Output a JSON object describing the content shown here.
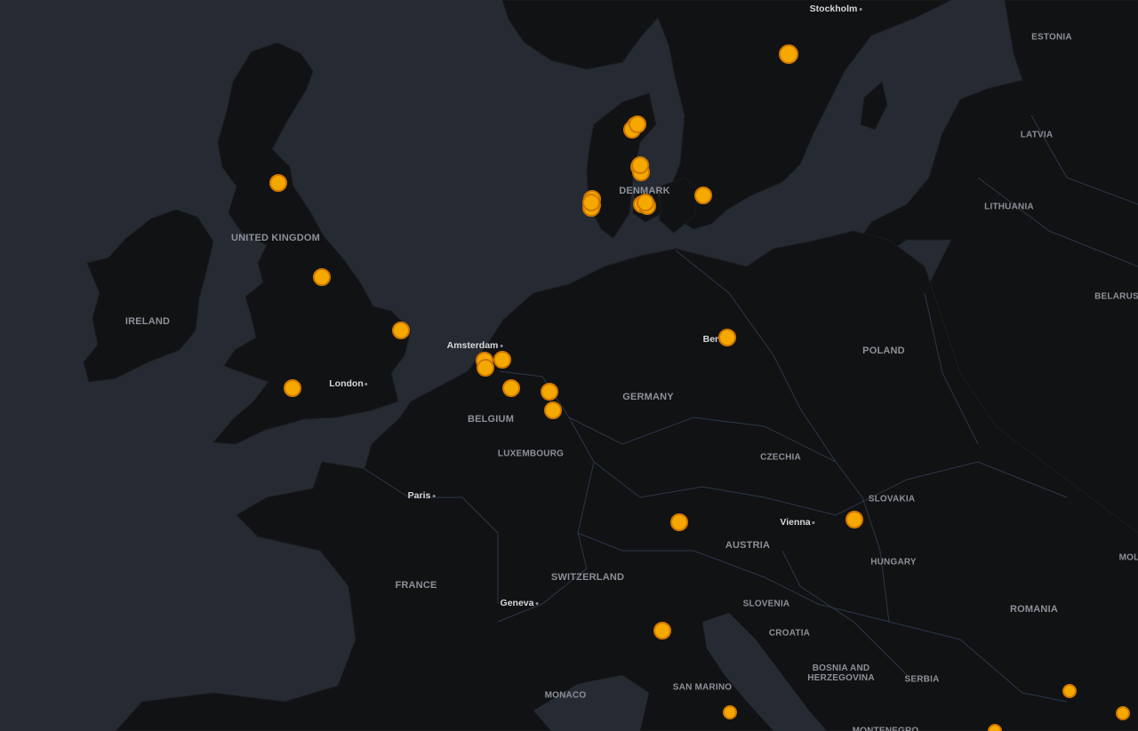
{
  "map": {
    "basemap": "dark",
    "colors": {
      "water": "#262b33",
      "land": "#111214",
      "border": "#2e3d4f",
      "marker_fill": "#f5a800",
      "marker_stroke": "#d07800"
    },
    "country_labels": [
      {
        "id": "estonia",
        "text": "ESTONIA"
      },
      {
        "id": "latvia",
        "text": "LATVIA"
      },
      {
        "id": "lithuania",
        "text": "LITHUANIA"
      },
      {
        "id": "belarus",
        "text": "BELARUS"
      },
      {
        "id": "denmark",
        "text": "DENMARK"
      },
      {
        "id": "united-kingdom",
        "text": "UNITED KINGDOM"
      },
      {
        "id": "ireland",
        "text": "IRELAND"
      },
      {
        "id": "poland",
        "text": "POLAND"
      },
      {
        "id": "germany",
        "text": "GERMANY"
      },
      {
        "id": "belgium",
        "text": "BELGIUM"
      },
      {
        "id": "luxembourg",
        "text": "LUXEMBOURG"
      },
      {
        "id": "czechia",
        "text": "CZECHIA"
      },
      {
        "id": "slovakia",
        "text": "SLOVAKIA"
      },
      {
        "id": "austria",
        "text": "AUSTRIA"
      },
      {
        "id": "hungary",
        "text": "HUNGARY"
      },
      {
        "id": "moldova",
        "text": "MOL"
      },
      {
        "id": "france",
        "text": "FRANCE"
      },
      {
        "id": "switzerland",
        "text": "SWITZERLAND"
      },
      {
        "id": "slovenia",
        "text": "SLOVENIA"
      },
      {
        "id": "croatia",
        "text": "CROATIA"
      },
      {
        "id": "romania",
        "text": "ROMANIA"
      },
      {
        "id": "bosnia",
        "text": "BOSNIA AND\nHERZEGOVINA"
      },
      {
        "id": "serbia",
        "text": "SERBIA"
      },
      {
        "id": "san-marino",
        "text": "SAN MARINO"
      },
      {
        "id": "monaco",
        "text": "MONACO"
      },
      {
        "id": "montenegro",
        "text": "MONTENEGRO"
      }
    ],
    "city_labels": [
      {
        "id": "stockholm",
        "text": "Stockholm"
      },
      {
        "id": "amsterdam",
        "text": "Amsterdam"
      },
      {
        "id": "london",
        "text": "London"
      },
      {
        "id": "berlin",
        "text": "Berlin"
      },
      {
        "id": "paris",
        "text": "Paris"
      },
      {
        "id": "vienna",
        "text": "Vienna"
      },
      {
        "id": "geneva",
        "text": "Geneva"
      }
    ],
    "marker_count": 33
  }
}
